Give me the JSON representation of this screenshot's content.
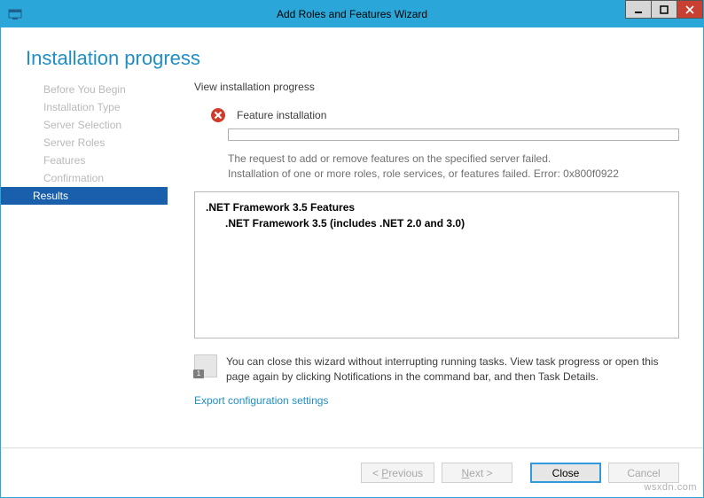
{
  "window": {
    "title": "Add Roles and Features Wizard"
  },
  "header": {
    "title": "Installation progress"
  },
  "sidebar": {
    "items": [
      {
        "label": "Before You Begin"
      },
      {
        "label": "Installation Type"
      },
      {
        "label": "Server Selection"
      },
      {
        "label": "Server Roles"
      },
      {
        "label": "Features"
      },
      {
        "label": "Confirmation"
      },
      {
        "label": "Results"
      }
    ]
  },
  "content": {
    "subtitle": "View installation progress",
    "status": "Feature installation",
    "error_line1": "The request to add or remove features on the specified server failed.",
    "error_line2": "Installation of one or more roles, role services, or features failed. Error: 0x800f0922",
    "feature_parent": ".NET Framework 3.5 Features",
    "feature_child": ".NET Framework 3.5 (includes .NET 2.0 and 3.0)",
    "info_text": "You can close this wizard without interrupting running tasks. View task progress or open this page again by clicking Notifications in the command bar, and then Task Details.",
    "info_badge": "1",
    "export_link": "Export configuration settings"
  },
  "footer": {
    "previous": "< Previous",
    "next": "Next >",
    "close": "Close",
    "cancel": "Cancel"
  },
  "watermark": "wsxdn.com"
}
